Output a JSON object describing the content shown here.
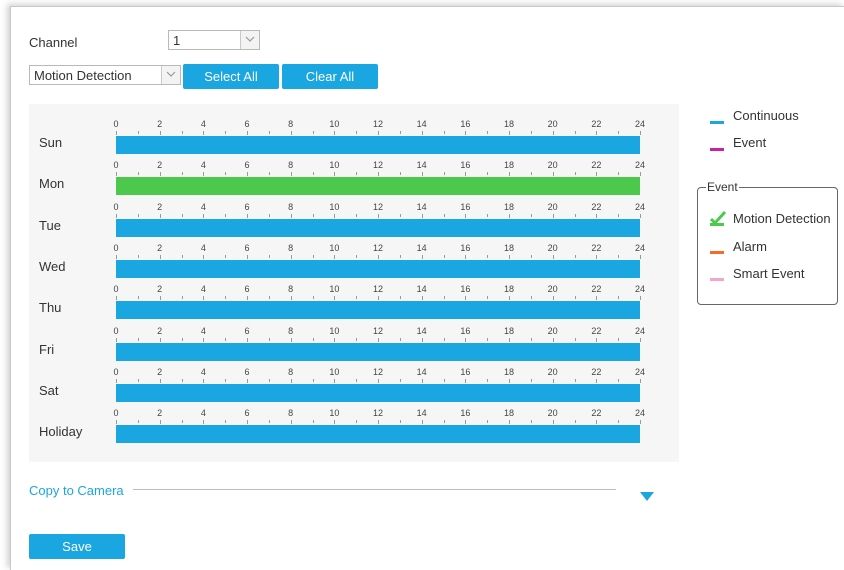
{
  "channel": {
    "label": "Channel",
    "value": "1"
  },
  "mode": {
    "value": "Motion Detection"
  },
  "buttons": {
    "select_all": "Select All",
    "clear_all": "Clear All",
    "save": "Save"
  },
  "schedule": {
    "ticks": [
      "0",
      "2",
      "4",
      "6",
      "8",
      "10",
      "12",
      "14",
      "16",
      "18",
      "20",
      "22",
      "24"
    ],
    "days": [
      {
        "label": "Sun",
        "type": "continuous"
      },
      {
        "label": "Mon",
        "type": "motion"
      },
      {
        "label": "Tue",
        "type": "continuous"
      },
      {
        "label": "Wed",
        "type": "continuous"
      },
      {
        "label": "Thu",
        "type": "continuous"
      },
      {
        "label": "Fri",
        "type": "continuous"
      },
      {
        "label": "Sat",
        "type": "continuous"
      },
      {
        "label": "Holiday",
        "type": "continuous"
      }
    ]
  },
  "legend": {
    "continuous": "Continuous",
    "event": "Event",
    "event_group_title": "Event",
    "motion_detection": "Motion Detection",
    "alarm": "Alarm",
    "smart_event": "Smart Event"
  },
  "copy": {
    "label": "Copy to Camera"
  },
  "colors": {
    "continuous": "#1aa6e0",
    "event": "#cc1fa8",
    "motion": "#4cc94c",
    "alarm": "#f46b2c",
    "smart_event": "#f3a7c8",
    "accent": "#1aa6e0"
  }
}
